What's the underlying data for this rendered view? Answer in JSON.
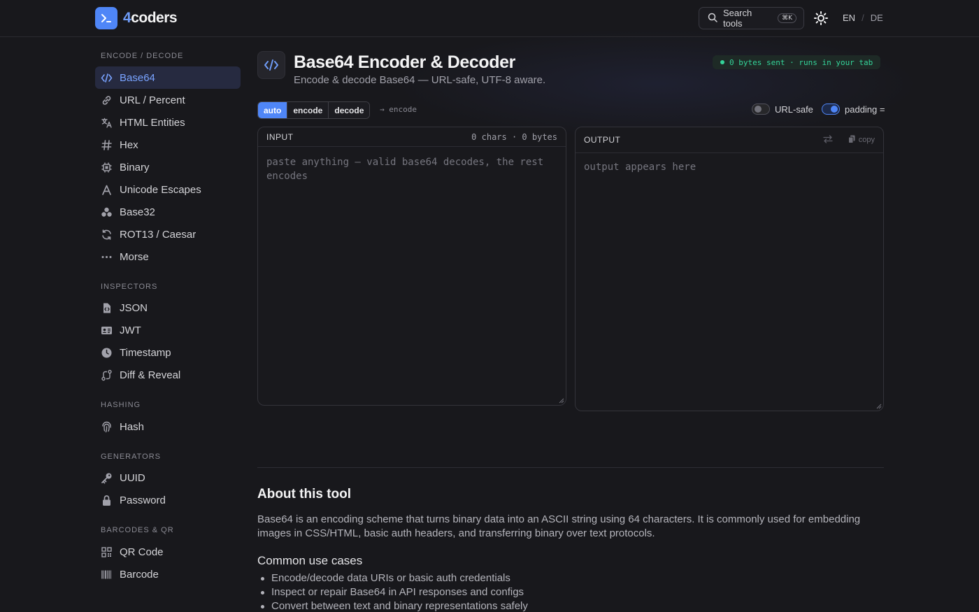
{
  "header": {
    "logo_prefix": "4",
    "logo_suffix": "coders",
    "search_label": "Search tools",
    "search_shortcut": "⌘K",
    "lang_active": "EN",
    "lang_sep": "/",
    "lang_other": "DE"
  },
  "sidebar": {
    "groups": [
      {
        "title": "ENCODE / DECODE",
        "items": [
          {
            "label": "Base64",
            "icon": "code-icon",
            "active": true
          },
          {
            "label": "URL / Percent",
            "icon": "link-icon"
          },
          {
            "label": "HTML Entities",
            "icon": "translate-icon"
          },
          {
            "label": "Hex",
            "icon": "hash-icon"
          },
          {
            "label": "Binary",
            "icon": "chip-icon"
          },
          {
            "label": "Unicode Escapes",
            "icon": "letter-a-icon"
          },
          {
            "label": "Base32",
            "icon": "cubes-icon"
          },
          {
            "label": "ROT13 / Caesar",
            "icon": "refresh-icon"
          },
          {
            "label": "Morse",
            "icon": "dots-icon"
          }
        ]
      },
      {
        "title": "INSPECTORS",
        "items": [
          {
            "label": "JSON",
            "icon": "file-code-icon"
          },
          {
            "label": "JWT",
            "icon": "id-card-icon"
          },
          {
            "label": "Timestamp",
            "icon": "clock-icon"
          },
          {
            "label": "Diff & Reveal",
            "icon": "git-compare-icon"
          }
        ]
      },
      {
        "title": "HASHING",
        "items": [
          {
            "label": "Hash",
            "icon": "fingerprint-icon"
          }
        ]
      },
      {
        "title": "GENERATORS",
        "items": [
          {
            "label": "UUID",
            "icon": "key-icon"
          },
          {
            "label": "Password",
            "icon": "lock-icon"
          }
        ]
      },
      {
        "title": "BARCODES & QR",
        "items": [
          {
            "label": "QR Code",
            "icon": "qr-icon"
          },
          {
            "label": "Barcode",
            "icon": "barcode-icon"
          }
        ]
      }
    ]
  },
  "tool": {
    "title": "Base64 Encoder & Decoder",
    "subtitle": "Encode & decode Base64 — URL-safe, UTF-8 aware.",
    "privacy_badge": "0 bytes sent · runs in your tab",
    "modes": [
      "auto",
      "encode",
      "decode"
    ],
    "active_mode": "auto",
    "mode_hint": "→ encode",
    "toggles": [
      {
        "label": "URL-safe",
        "on": false
      },
      {
        "label": "padding =",
        "on": true
      }
    ]
  },
  "input_panel": {
    "title": "INPUT",
    "meta": "0 chars · 0 bytes",
    "value": "",
    "placeholder": "paste anything — valid base64 decodes, the rest encodes"
  },
  "output_panel": {
    "title": "OUTPUT",
    "copy_label": "copy",
    "placeholder": "output appears here"
  },
  "about": {
    "title": "About this tool",
    "body": "Base64 is an encoding scheme that turns binary data into an ASCII string using 64 characters. It is commonly used for embedding images in CSS/HTML, basic auth headers, and transferring binary over text protocols.",
    "use_cases_title": "Common use cases",
    "use_cases": [
      "Encode/decode data URIs or basic auth credentials",
      "Inspect or repair Base64 in API responses and configs",
      "Convert between text and binary representations safely"
    ]
  },
  "colors": {
    "background": "#18181c",
    "accent": "#4f86f7",
    "success": "#34d399"
  }
}
